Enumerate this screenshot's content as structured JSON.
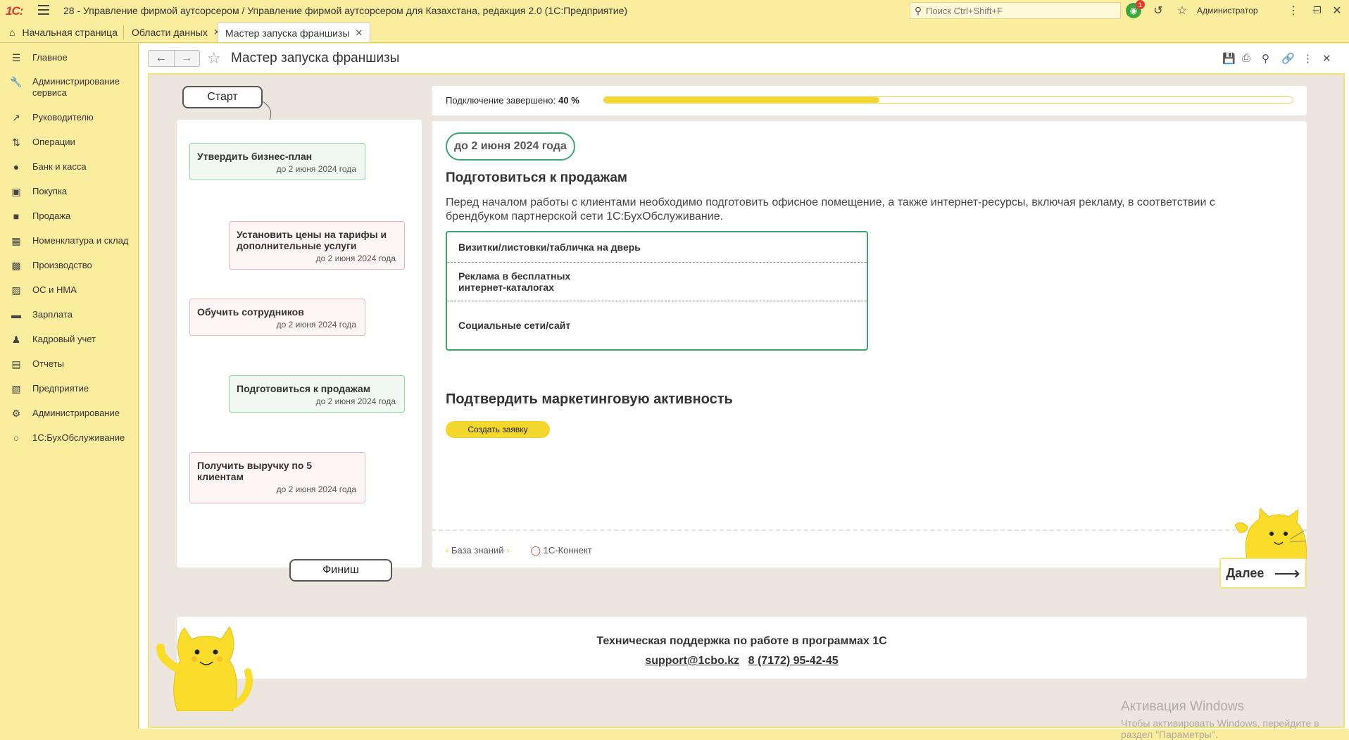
{
  "app": {
    "logo": "1С:",
    "title": "28 - Управление фирмой аутсорсером / Управление фирмой аутсорсером для Казахстана, редакция 2.0  (1С:Предприятие)",
    "search_placeholder": "Поиск Ctrl+Shift+F",
    "notification_count": "1",
    "user": "Администратор"
  },
  "tabs": [
    {
      "label": "Начальная страница"
    },
    {
      "label": "Области данных"
    },
    {
      "label": "Мастер запуска франшизы"
    }
  ],
  "sidebar": {
    "items": [
      {
        "label": "Главное",
        "icon": "menu-icon"
      },
      {
        "label": "Администрирование сервиса",
        "icon": "wrench-icon"
      },
      {
        "label": "Руководителю",
        "icon": "trend-icon"
      },
      {
        "label": "Операции",
        "icon": "operations-icon"
      },
      {
        "label": "Банк и касса",
        "icon": "coin-icon"
      },
      {
        "label": "Покупка",
        "icon": "cart-icon"
      },
      {
        "label": "Продажа",
        "icon": "bag-icon"
      },
      {
        "label": "Номенклатура и склад",
        "icon": "grid-icon"
      },
      {
        "label": "Производство",
        "icon": "factory-icon"
      },
      {
        "label": "ОС и НМА",
        "icon": "truck-icon"
      },
      {
        "label": "Зарплата",
        "icon": "wallet-icon"
      },
      {
        "label": "Кадровый учет",
        "icon": "people-icon"
      },
      {
        "label": "Отчеты",
        "icon": "chart-icon"
      },
      {
        "label": "Предприятие",
        "icon": "building-icon"
      },
      {
        "label": "Администрирование",
        "icon": "gear-icon"
      },
      {
        "label": "1С:БухОбслуживание",
        "icon": "circle-icon"
      }
    ]
  },
  "page": {
    "title": "Мастер запуска франшизы"
  },
  "flow": {
    "start": "Старт",
    "finish": "Финиш",
    "steps": [
      {
        "title": "Утвердить бизнес-план",
        "date": "до 2 июня 2024 года"
      },
      {
        "title": "Установить цены на тарифы и дополнительные услуги",
        "date": "до 2 июня 2024 года"
      },
      {
        "title": "Обучить сотрудников",
        "date": "до 2 июня 2024 года"
      },
      {
        "title": "Подготовиться к продажам",
        "date": "до 2 июня 2024 года"
      },
      {
        "title": "Получить выручку по 5 клиентам",
        "date": "до 2 июня 2024 года"
      }
    ]
  },
  "progress": {
    "label": "Подключение завершено:",
    "value_text": "40 %",
    "value": 0.4
  },
  "content": {
    "deadline": "до 2 июня 2024 года",
    "title": "Подготовиться к продажам",
    "description": "Перед началом работы с клиентами необходимо подготовить офисное помещение, а также интернет-ресурсы, включая рекламу, в соответствии с брендбуком партнерской сети 1С:БухОбслуживание.",
    "tasks": [
      "Визитки/листовки/табличка на дверь",
      "Реклама в бесплатных интернет-каталогах",
      "Социальные сети/сайт"
    ],
    "section2_title": "Подтвердить маркетинговую активность",
    "create_button": "Создать заявку",
    "link_kb": "База знаний",
    "link_connect": "1С-Коннект",
    "next_button": "Далее"
  },
  "support": {
    "title": "Техническая поддержка по работе в программах 1С",
    "email": "support@1cbo.kz",
    "phone": "8 (7172) 95-42-45"
  },
  "watermark": {
    "line1": "Активация Windows",
    "line2": "Чтобы активировать Windows, перейдите в раздел \"Параметры\"."
  },
  "colors": {
    "accent_yellow": "#f4d72c",
    "panel_bg": "#fbed9e",
    "done_green": "#3ea66a",
    "pending_pink": "#f2b5bf"
  }
}
